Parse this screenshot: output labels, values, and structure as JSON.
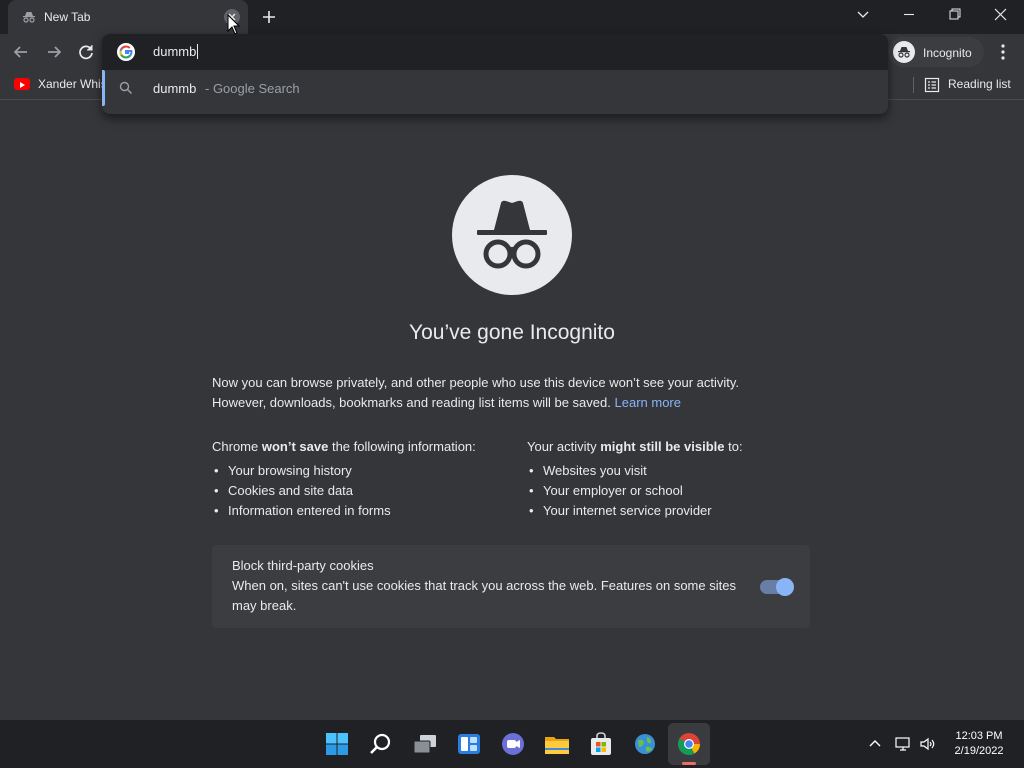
{
  "tab": {
    "title": "New Tab",
    "icon": "incognito-icon"
  },
  "toolbar": {
    "back_icon": "arrow-left-icon",
    "forward_icon": "arrow-right-icon",
    "reload_icon": "reload-icon",
    "profile_label": "Incognito",
    "menu_icon": "kebab-icon"
  },
  "bookmarks": {
    "items": [
      {
        "label": "Xander Whis",
        "icon": "youtube-icon"
      }
    ],
    "reading_list_label": "Reading list"
  },
  "omnibox": {
    "input_value": "dummb",
    "suggestions": [
      {
        "query": "dummb",
        "type": "- Google Search",
        "icon": "search-icon"
      }
    ]
  },
  "incognito": {
    "heading": "You’ve gone Incognito",
    "intro_line1": "Now you can browse privately, and other people who use this device won’t see your activity.",
    "intro_line2": "However, downloads, bookmarks and reading list items will be saved.",
    "learn_more": "Learn more",
    "wont_save": {
      "heading_prefix": "Chrome",
      "heading_bold": "won’t save",
      "heading_suffix": "the following information:",
      "items": [
        "Your browsing history",
        "Cookies and site data",
        "Information entered in forms"
      ]
    },
    "might_be_visible": {
      "heading_prefix": "Your activity",
      "heading_bold": "might still be visible",
      "heading_suffix": "to:",
      "items": [
        "Websites you visit",
        "Your employer or school",
        "Your internet service provider"
      ]
    },
    "cookies_card": {
      "title": "Block third-party cookies",
      "description": "When on, sites can't use cookies that track you across the web. Features on some sites may break.",
      "toggle_on": true
    }
  },
  "taskbar": {
    "apps": [
      "windows-start-icon",
      "search-icon",
      "task-view-icon",
      "widgets-icon",
      "chat-icon",
      "file-explorer-icon",
      "store-icon",
      "weather-icon",
      "chrome-icon"
    ],
    "time": "12:03 PM",
    "date": "2/19/2022"
  },
  "colors": {
    "accent": "#8ab4f8",
    "background": "#35363a",
    "frame": "#202124",
    "youtube": "#ff0000"
  }
}
